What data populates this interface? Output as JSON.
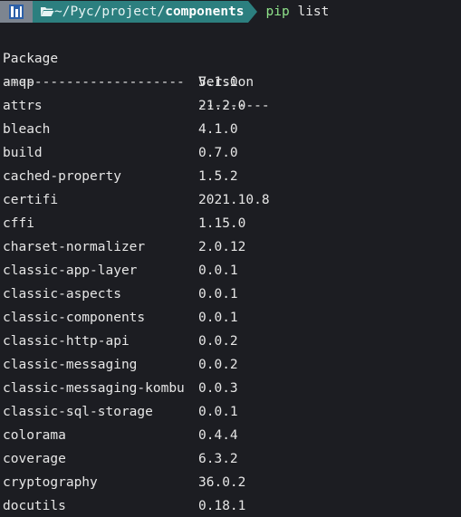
{
  "prompt": {
    "icon": "folder-open-icon",
    "path_prefix": "~/Pyc/project/",
    "path_bold": "components",
    "command": "pip",
    "args": "list"
  },
  "header": {
    "package": "Package",
    "version": "Version"
  },
  "separator": {
    "package": "-----------------------",
    "version": "---------"
  },
  "rows": [
    {
      "package": "amqp",
      "version": "5.1.0"
    },
    {
      "package": "attrs",
      "version": "21.2.0"
    },
    {
      "package": "bleach",
      "version": "4.1.0"
    },
    {
      "package": "build",
      "version": "0.7.0"
    },
    {
      "package": "cached-property",
      "version": "1.5.2"
    },
    {
      "package": "certifi",
      "version": "2021.10.8"
    },
    {
      "package": "cffi",
      "version": "1.15.0"
    },
    {
      "package": "charset-normalizer",
      "version": "2.0.12"
    },
    {
      "package": "classic-app-layer",
      "version": "0.0.1"
    },
    {
      "package": "classic-aspects",
      "version": "0.0.1"
    },
    {
      "package": "classic-components",
      "version": "0.0.1"
    },
    {
      "package": "classic-http-api",
      "version": "0.0.2"
    },
    {
      "package": "classic-messaging",
      "version": "0.0.2"
    },
    {
      "package": "classic-messaging-kombu",
      "version": "0.0.3"
    },
    {
      "package": "classic-sql-storage",
      "version": "0.0.1"
    },
    {
      "package": "colorama",
      "version": "0.4.4"
    },
    {
      "package": "coverage",
      "version": "6.3.2"
    },
    {
      "package": "cryptography",
      "version": "36.0.2"
    },
    {
      "package": "docutils",
      "version": "0.18.1"
    }
  ]
}
